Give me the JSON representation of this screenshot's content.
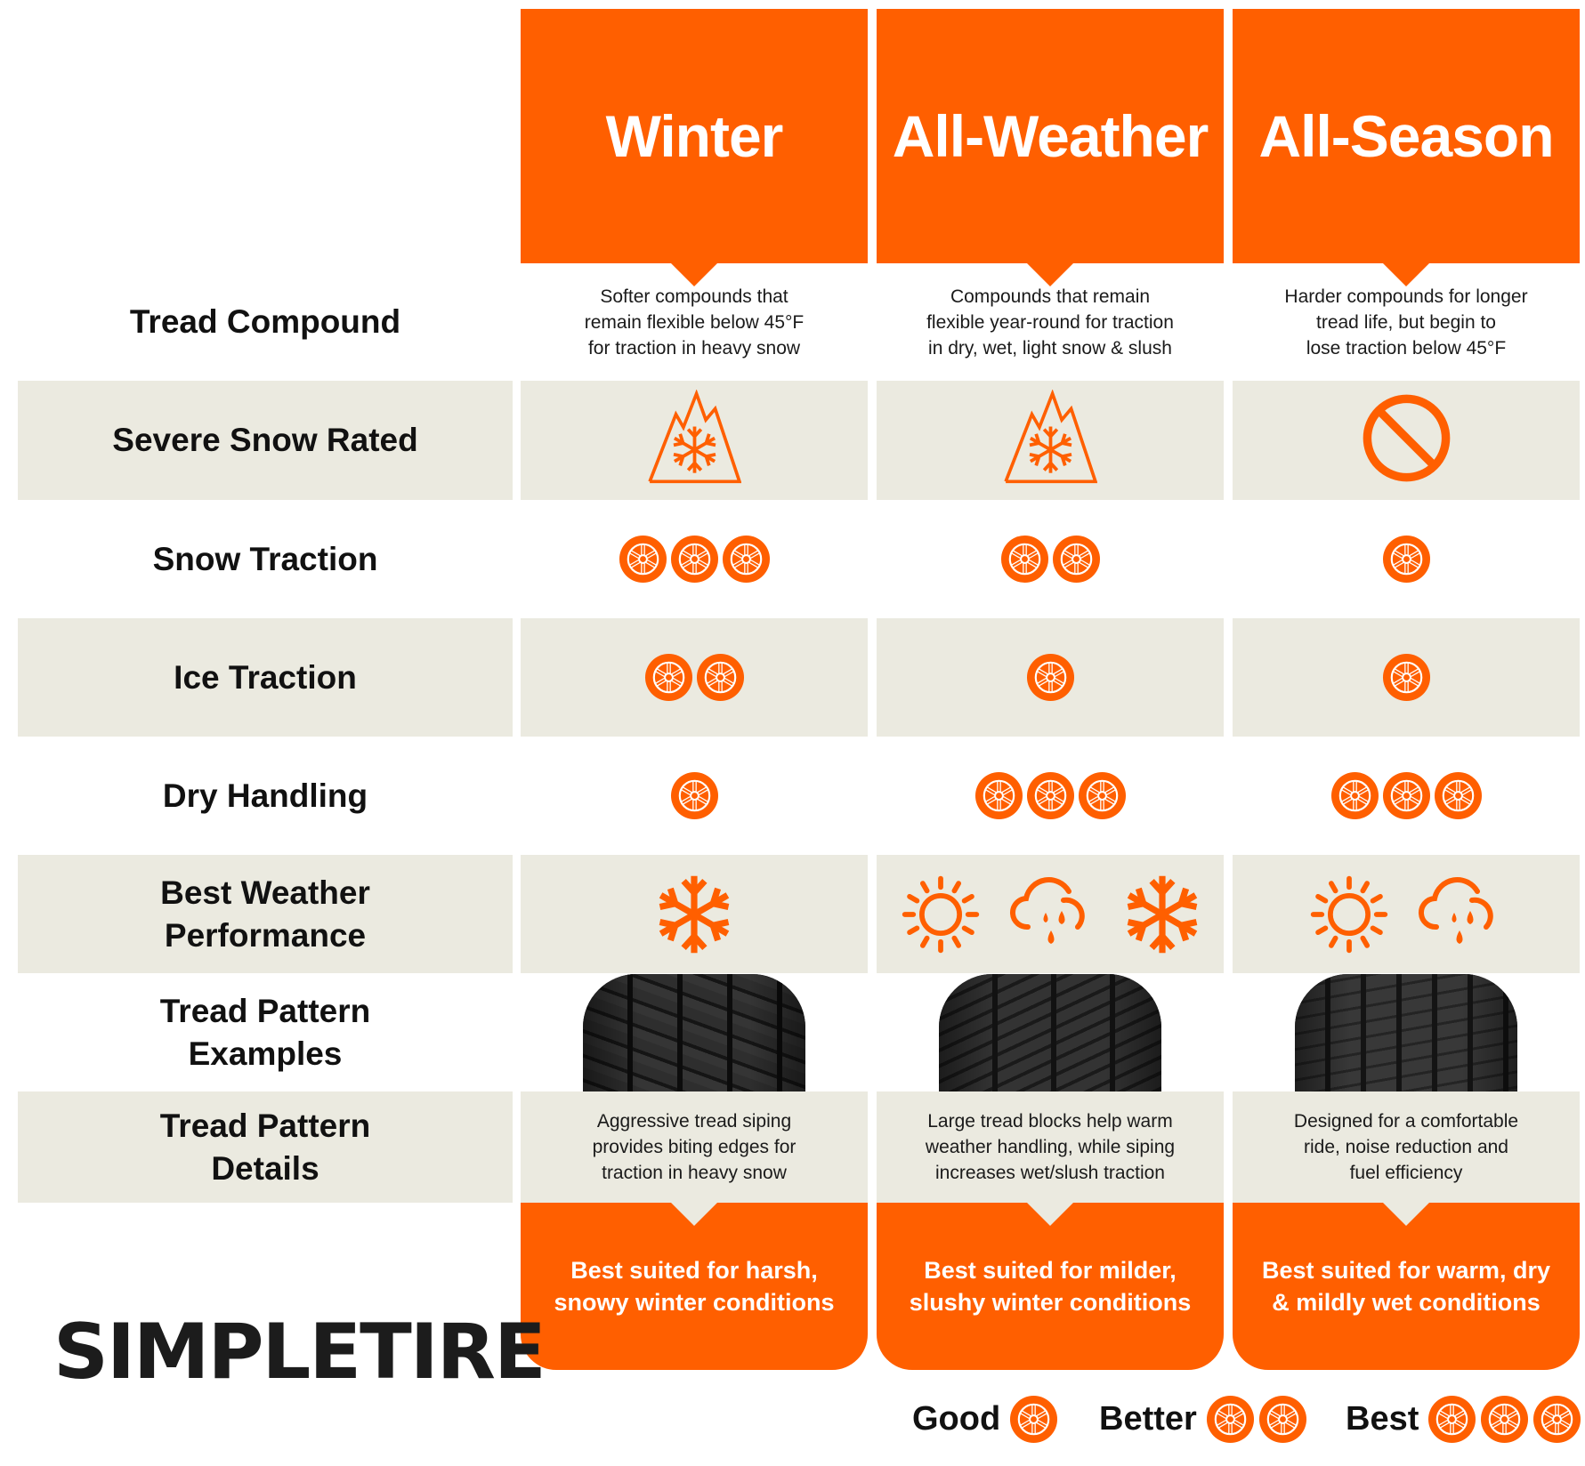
{
  "colors": {
    "accent": "#ff5f00",
    "row_shade": "#ebeae0",
    "text": "#111111"
  },
  "columns": [
    {
      "title": "Winter",
      "tread_compound": [
        "Softer compounds that",
        "remain flexible below 45°F",
        "for traction in heavy snow"
      ],
      "severe_snow_rated": true,
      "severe_snow_icon": "mountain-snowflake-icon",
      "snow_traction": 3,
      "ice_traction": 2,
      "dry_handling": 1,
      "weather_icons": [
        "snowflake-icon"
      ],
      "tread_image": "winter-tread-pattern",
      "tread_details": [
        "Aggressive tread siping",
        "provides biting edges for",
        "traction in  heavy snow"
      ],
      "summary": [
        "Best suited for harsh,",
        "snowy winter conditions"
      ]
    },
    {
      "title": "All-Weather",
      "tread_compound": [
        "Compounds that remain",
        "flexible year-round for traction",
        "in dry, wet, light snow & slush"
      ],
      "severe_snow_rated": true,
      "severe_snow_icon": "mountain-snowflake-icon",
      "snow_traction": 2,
      "ice_traction": 1,
      "dry_handling": 3,
      "weather_icons": [
        "sun-icon",
        "rain-cloud-icon",
        "snowflake-icon"
      ],
      "tread_image": "all-weather-tread-pattern",
      "tread_details": [
        "Large tread blocks help warm",
        "weather handling, while siping",
        "increases wet/slush traction"
      ],
      "summary": [
        "Best suited for milder,",
        "slushy winter conditions"
      ]
    },
    {
      "title": "All-Season",
      "tread_compound": [
        "Harder compounds for longer",
        "tread life, but begin to",
        "lose traction below 45°F"
      ],
      "severe_snow_rated": false,
      "severe_snow_icon": "prohibited-icon",
      "snow_traction": 1,
      "ice_traction": 1,
      "dry_handling": 3,
      "weather_icons": [
        "sun-icon",
        "rain-cloud-icon"
      ],
      "tread_image": "all-season-tread-pattern",
      "tread_details": [
        "Designed for a comfortable",
        "ride, noise reduction and",
        "fuel efficiency"
      ],
      "summary": [
        "Best suited for warm, dry",
        "& mildly wet conditions"
      ]
    }
  ],
  "row_labels": {
    "tread_compound": [
      "Tread Compound"
    ],
    "severe_snow_rated": [
      "Severe Snow Rated"
    ],
    "snow_traction": [
      "Snow Traction"
    ],
    "ice_traction": [
      "Ice Traction"
    ],
    "dry_handling": [
      "Dry Handling"
    ],
    "best_weather": [
      "Best Weather",
      "Performance"
    ],
    "tread_examples": [
      "Tread Pattern",
      "Examples"
    ],
    "tread_details": [
      "Tread Pattern",
      "Details"
    ]
  },
  "logo": "SIMPLETIRE",
  "legend": [
    {
      "label": "Good",
      "count": 1
    },
    {
      "label": "Better",
      "count": 2
    },
    {
      "label": "Best",
      "count": 3
    }
  ]
}
